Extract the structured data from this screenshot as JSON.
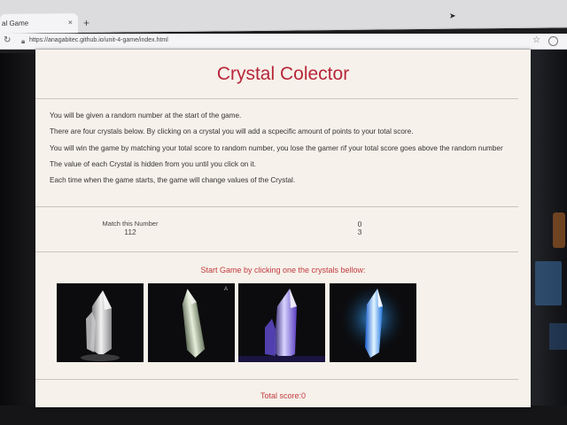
{
  "browser": {
    "tab_title": "al Game",
    "tab_close": "×",
    "new_tab": "+",
    "url": "https://anagabitec.github.io/unit-4-game/index.html"
  },
  "page": {
    "title": "Crystal Colector",
    "instructions": [
      "You will be given a random number at the start of the game.",
      "There are four crystals below. By clicking on a crystal you will add a scpecific amount of points to your total score.",
      "You will win the game by matching your total score to random number, you lose the gamer rif your total score goes above the random number",
      "The value of each Crystal is hidden from you until you click on it.",
      "Each time when the game starts, the game will change values of the Crystal."
    ],
    "match_label": "Match this Number",
    "match_value": "112",
    "wins": "0",
    "losses": "3",
    "prompt": "Start Game by clicking one the crystals bellow:",
    "total_score": "Total score:0"
  },
  "icons": {
    "reload": "reload-icon",
    "lock": "lock-icon",
    "star": "bookmark-star-icon",
    "profile": "profile-icon"
  },
  "colors": {
    "title": "#b8273b",
    "accent": "#c23a3f",
    "page_bg": "#f6f1ea"
  }
}
